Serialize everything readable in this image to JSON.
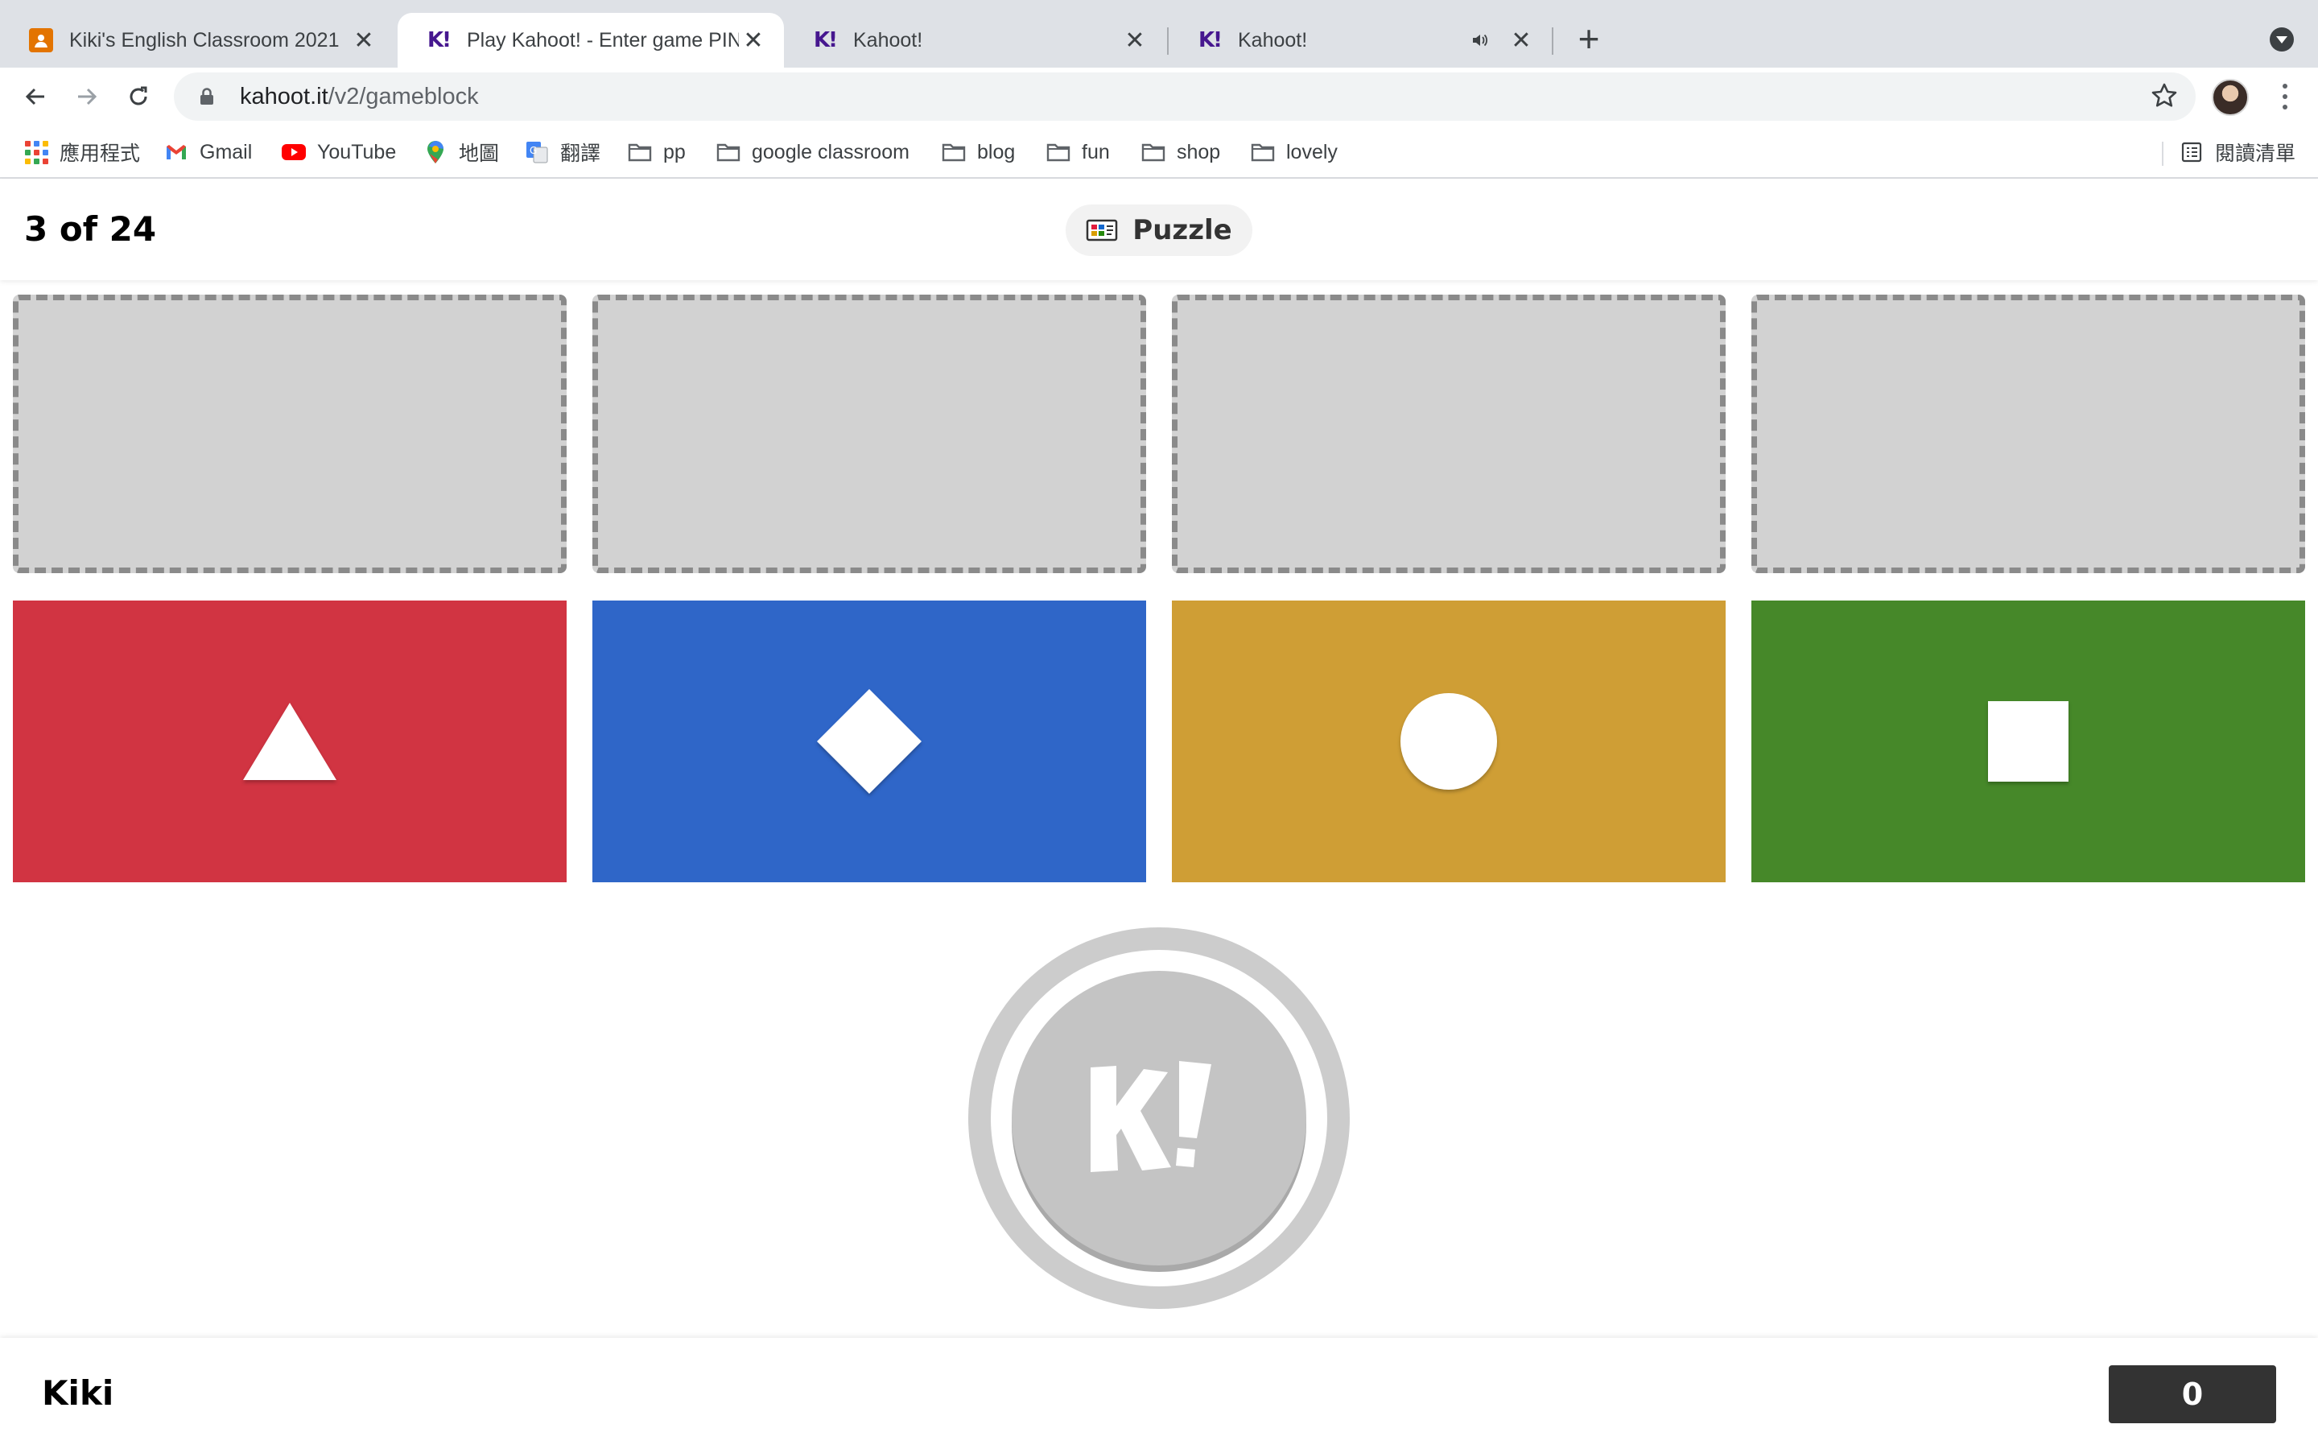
{
  "browser": {
    "tabs": [
      {
        "title": "Kiki's English Classroom 2021",
        "favicon": "classroom-icon",
        "active": false
      },
      {
        "title": "Play Kahoot! - Enter game PIN",
        "favicon": "kahoot-icon",
        "active": true
      },
      {
        "title": "Kahoot!",
        "favicon": "kahoot-icon",
        "active": false
      },
      {
        "title": "Kahoot!",
        "favicon": "kahoot-icon",
        "active": false,
        "audio": true
      }
    ],
    "favicon_text": "K!",
    "address": {
      "host": "kahoot.it",
      "path": "/v2/gameblock"
    },
    "bookmarks": [
      {
        "label": "應用程式",
        "icon": "apps-icon"
      },
      {
        "label": "Gmail",
        "icon": "gmail-icon"
      },
      {
        "label": "YouTube",
        "icon": "youtube-icon"
      },
      {
        "label": "地圖",
        "icon": "maps-icon"
      },
      {
        "label": "翻譯",
        "icon": "translate-icon"
      },
      {
        "label": "pp",
        "icon": "folder-icon"
      },
      {
        "label": "google classroom",
        "icon": "folder-icon"
      },
      {
        "label": "blog",
        "icon": "folder-icon"
      },
      {
        "label": "fun",
        "icon": "folder-icon"
      },
      {
        "label": "shop",
        "icon": "folder-icon"
      },
      {
        "label": "lovely",
        "icon": "folder-icon"
      }
    ],
    "reading_list": "閱讀清單"
  },
  "game": {
    "question_counter": "3 of 24",
    "question_type": "Puzzle",
    "answer_slots": 4,
    "answers": [
      {
        "shape": "triangle",
        "color": "#d13442"
      },
      {
        "shape": "diamond",
        "color": "#2f66c8"
      },
      {
        "shape": "circle",
        "color": "#cf9e35"
      },
      {
        "shape": "square",
        "color": "#468829"
      }
    ],
    "timer_logo": "K!",
    "player_name": "Kiki",
    "score": "0"
  }
}
